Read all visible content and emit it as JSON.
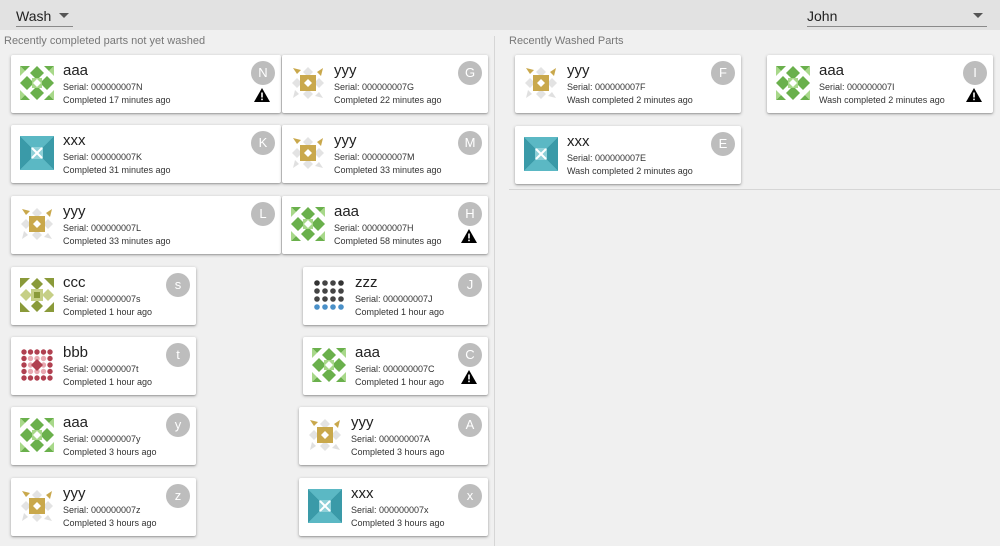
{
  "header": {
    "station": {
      "value": "Wash"
    },
    "operator": {
      "value": "John"
    }
  },
  "left_panel": {
    "title": "Recently completed parts not yet washed",
    "cards": [
      {
        "name": "aaa",
        "serial": "Serial: 000000007N",
        "status": "Completed 17 minutes ago",
        "badge": "N",
        "warning": true,
        "icon": "aaa-green-quilt-icon"
      },
      {
        "name": "yyy",
        "serial": "Serial: 000000007G",
        "status": "Completed 22 minutes ago",
        "badge": "G",
        "warning": false,
        "icon": "yyy-gold-quilt-icon"
      },
      {
        "name": "xxx",
        "serial": "Serial: 000000007K",
        "status": "Completed 31 minutes ago",
        "badge": "K",
        "warning": false,
        "icon": "xxx-teal-quilt-icon"
      },
      {
        "name": "yyy",
        "serial": "Serial: 000000007M",
        "status": "Completed 33 minutes ago",
        "badge": "M",
        "warning": false,
        "icon": "yyy-gold-quilt-icon"
      },
      {
        "name": "yyy",
        "serial": "Serial: 000000007L",
        "status": "Completed 33 minutes ago",
        "badge": "L",
        "warning": false,
        "icon": "yyy-gold-quilt-icon"
      },
      {
        "name": "aaa",
        "serial": "Serial: 000000007H",
        "status": "Completed 58 minutes ago",
        "badge": "H",
        "warning": true,
        "icon": "aaa-green-quilt-icon"
      },
      {
        "name": "ccc",
        "serial": "Serial: 000000007s",
        "status": "Completed 1 hour ago",
        "badge": "s",
        "warning": false,
        "icon": "ccc-olive-quilt-icon"
      },
      {
        "name": "zzz",
        "serial": "Serial: 000000007J",
        "status": "Completed 1 hour ago",
        "badge": "J",
        "warning": false,
        "icon": "zzz-dots-quilt-icon"
      },
      {
        "name": "bbb",
        "serial": "Serial: 000000007t",
        "status": "Completed 1 hour ago",
        "badge": "t",
        "warning": false,
        "icon": "bbb-red-quilt-icon"
      },
      {
        "name": "aaa",
        "serial": "Serial: 000000007C",
        "status": "Completed 1 hour ago",
        "badge": "C",
        "warning": true,
        "icon": "aaa-green-quilt-icon"
      },
      {
        "name": "aaa",
        "serial": "Serial: 000000007y",
        "status": "Completed 3 hours ago",
        "badge": "y",
        "warning": false,
        "icon": "aaa-green-quilt-icon"
      },
      {
        "name": "yyy",
        "serial": "Serial: 000000007A",
        "status": "Completed 3 hours ago",
        "badge": "A",
        "warning": false,
        "icon": "yyy-gold-quilt-icon"
      },
      {
        "name": "yyy",
        "serial": "Serial: 000000007z",
        "status": "Completed 3 hours ago",
        "badge": "z",
        "warning": false,
        "icon": "yyy-gold-quilt-icon"
      },
      {
        "name": "xxx",
        "serial": "Serial: 000000007x",
        "status": "Completed 3 hours ago",
        "badge": "x",
        "warning": false,
        "icon": "xxx-teal-quilt-icon"
      }
    ]
  },
  "right_panel": {
    "title": "Recently Washed Parts",
    "cards": [
      {
        "name": "yyy",
        "serial": "Serial: 000000007F",
        "status": "Wash completed 2 minutes ago",
        "badge": "F",
        "warning": false,
        "icon": "yyy-gold-quilt-icon"
      },
      {
        "name": "aaa",
        "serial": "Serial: 000000007I",
        "status": "Wash completed 2 minutes ago",
        "badge": "I",
        "warning": true,
        "icon": "aaa-green-quilt-icon"
      },
      {
        "name": "xxx",
        "serial": "Serial: 000000007E",
        "status": "Wash completed 2 minutes ago",
        "badge": "E",
        "warning": false,
        "icon": "xxx-teal-quilt-icon"
      }
    ]
  },
  "colors": {
    "aaa": "#6ab04c",
    "yyy": "#c9a84c",
    "xxx": "#3a9aa8",
    "ccc": "#8a9a3a",
    "bbb": "#b04050",
    "zzz": "#4a90c8",
    "badge": "#bdbdbd",
    "warning": "#000000"
  }
}
